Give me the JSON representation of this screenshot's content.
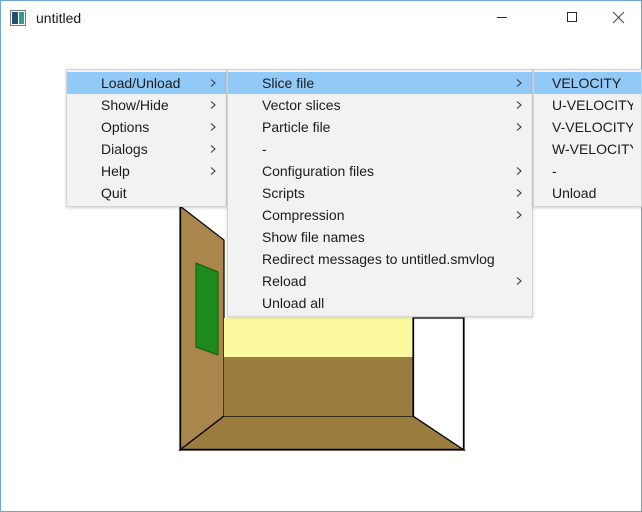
{
  "window": {
    "title": "untitled",
    "icon": "app-icon",
    "controls": [
      {
        "name": "minimize",
        "glyph": "minimize-icon"
      },
      {
        "name": "maximize",
        "glyph": "maximize-icon"
      },
      {
        "name": "close",
        "glyph": "close-icon"
      }
    ]
  },
  "scene": {
    "name": "3d-viewport",
    "description": "3D compartment geometry",
    "colors": {
      "wall_left": "#a9864b",
      "floor": "#9b7c3f",
      "back_wall_upper": "#fbf9a0",
      "door": "#1c8a1c",
      "outline": "#000000",
      "background": "#ffffff"
    }
  },
  "menus": {
    "main": {
      "name": "main-menu",
      "items": [
        {
          "label": "Load/Unload",
          "submenu": true,
          "selected": true
        },
        {
          "label": "Show/Hide",
          "submenu": true,
          "selected": false
        },
        {
          "label": "Options",
          "submenu": true,
          "selected": false
        },
        {
          "label": "Dialogs",
          "submenu": true,
          "selected": false
        },
        {
          "label": "Help",
          "submenu": true,
          "selected": false
        },
        {
          "label": "Quit",
          "submenu": false,
          "selected": false
        }
      ]
    },
    "load_unload": {
      "name": "load-unload-menu",
      "items": [
        {
          "label": "Slice file",
          "submenu": true,
          "selected": true
        },
        {
          "label": "Vector slices",
          "submenu": true,
          "selected": false
        },
        {
          "label": "Particle file",
          "submenu": true,
          "selected": false
        },
        {
          "label": "-",
          "submenu": false,
          "selected": false
        },
        {
          "label": "Configuration files",
          "submenu": true,
          "selected": false
        },
        {
          "label": "Scripts",
          "submenu": true,
          "selected": false
        },
        {
          "label": "Compression",
          "submenu": true,
          "selected": false
        },
        {
          "label": "Show file names",
          "submenu": false,
          "selected": false
        },
        {
          "label": "Redirect messages to untitled.smvlog",
          "submenu": false,
          "selected": false
        },
        {
          "label": "Reload",
          "submenu": true,
          "selected": false
        },
        {
          "label": "Unload all",
          "submenu": false,
          "selected": false
        }
      ]
    },
    "slice_file": {
      "name": "slice-file-menu",
      "items": [
        {
          "label": "VELOCITY",
          "submenu": false,
          "selected": true
        },
        {
          "label": "U-VELOCITY",
          "submenu": false,
          "selected": false
        },
        {
          "label": "V-VELOCITY",
          "submenu": false,
          "selected": false
        },
        {
          "label": "W-VELOCITY",
          "submenu": false,
          "selected": false
        },
        {
          "label": "-",
          "submenu": false,
          "selected": false
        },
        {
          "label": "Unload",
          "submenu": false,
          "selected": false
        }
      ]
    }
  }
}
